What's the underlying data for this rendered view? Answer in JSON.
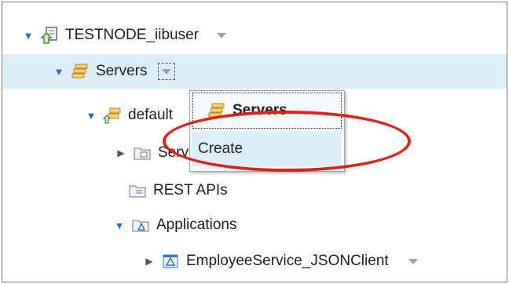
{
  "tree": {
    "node": {
      "label": "TESTNODE_iibuser",
      "icon": "integration-node-icon"
    },
    "servers": {
      "label": "Servers",
      "icon": "servers-icon"
    },
    "default_server": {
      "label": "default",
      "icon": "integration-server-icon"
    },
    "services": {
      "label": "Services",
      "icon": "services-folder-icon"
    },
    "rest_apis": {
      "label": "REST APIs",
      "icon": "rest-apis-icon"
    },
    "applications": {
      "label": "Applications",
      "icon": "applications-icon"
    },
    "employee_service": {
      "label": "EmployeeService_JSONClient",
      "icon": "application-icon"
    }
  },
  "context_menu": {
    "header_label": "Servers",
    "items": [
      "Create"
    ]
  },
  "colors": {
    "selection": "#dceef8",
    "annotation_ring": "#e0201b",
    "twisty": "#2a6fb0"
  }
}
